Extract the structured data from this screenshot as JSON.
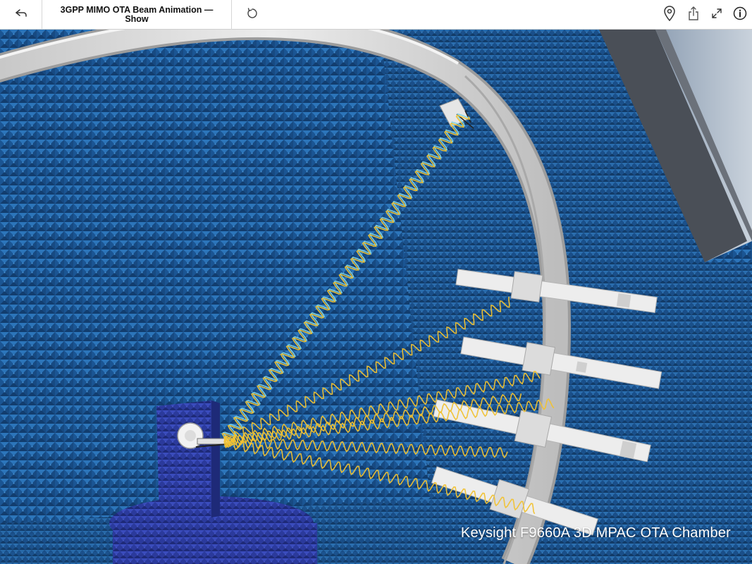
{
  "header": {
    "title": "3GPP MIMO OTA Beam Animation — Show"
  },
  "icons": {
    "back": "back-arrow-icon",
    "refresh": "refresh-icon",
    "location": "map-pin-icon",
    "share": "share-icon",
    "expand": "expand-icon",
    "info": "info-icon"
  },
  "scene": {
    "caption": "Keysight F9660A 3D MPAC OTA Chamber"
  },
  "colors": {
    "absorber": "#1f5d9e",
    "absorber_light": "#2f7cc3",
    "absorber_dark": "#123d6e",
    "pedestal": "#2b3a9c",
    "arch": "#d9d9d9",
    "wave": "#f1c232",
    "wave_alt": "#7fd3e6"
  }
}
